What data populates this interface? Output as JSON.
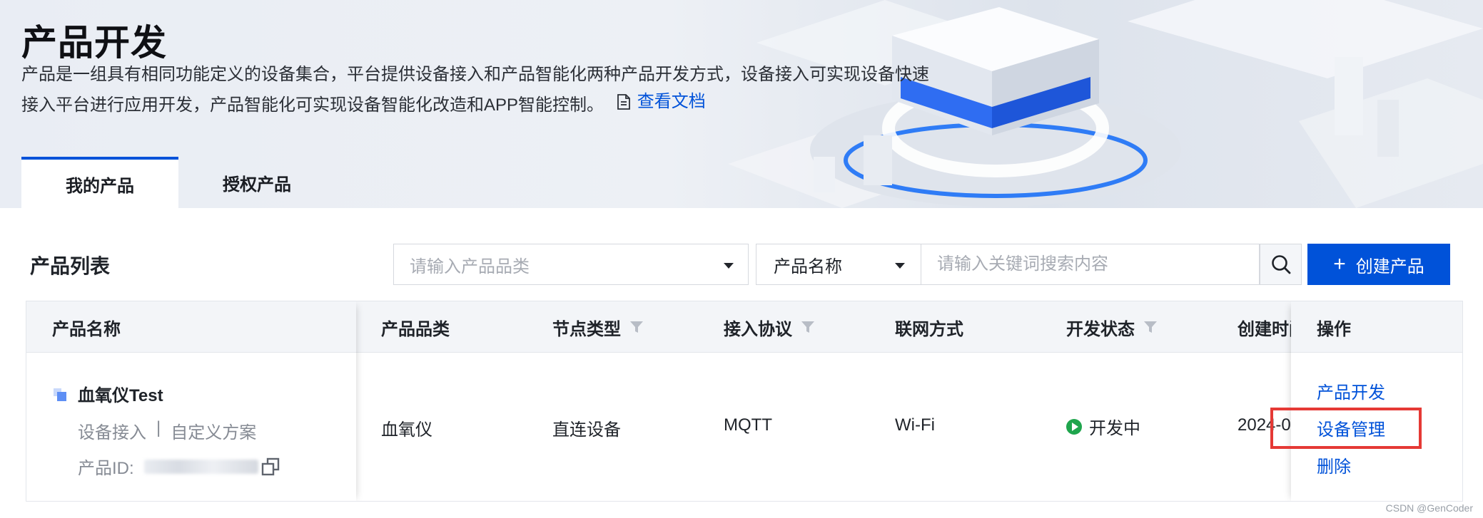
{
  "header": {
    "title": "产品开发",
    "description": "产品是一组具有相同功能定义的设备集合，平台提供设备接入和产品智能化两种产品开发方式，设备接入可实现设备快速接入平台进行应用开发，产品智能化可实现设备智能化改造和APP智能控制。",
    "doc_link": "查看文档",
    "tabs": [
      {
        "label": "我的产品",
        "active": true
      },
      {
        "label": "授权产品",
        "active": false
      }
    ]
  },
  "toolbar": {
    "list_title": "产品列表",
    "category_placeholder": "请输入产品品类",
    "search_field": "产品名称",
    "keyword_placeholder": "请输入关键词搜索内容",
    "create_label": "创建产品"
  },
  "table": {
    "columns": {
      "name": "产品名称",
      "category": "产品品类",
      "node_type": "节点类型",
      "protocol": "接入协议",
      "network": "联网方式",
      "status": "开发状态",
      "created": "创建时间",
      "actions": "操作"
    },
    "rows": [
      {
        "name": "血氧仪Test",
        "access": "设备接入",
        "separator": "|",
        "scheme": "自定义方案",
        "id_label": "产品ID:",
        "category": "血氧仪",
        "node_type": "直连设备",
        "protocol": "MQTT",
        "network": "Wi-Fi",
        "status": "开发中",
        "created": "2024-0",
        "actions": [
          "产品开发",
          "设备管理",
          "删除"
        ]
      }
    ]
  },
  "colors": {
    "primary": "#0052d9",
    "success": "#1fa54d",
    "highlight": "#e53935"
  },
  "watermark": "CSDN @GenCoder"
}
